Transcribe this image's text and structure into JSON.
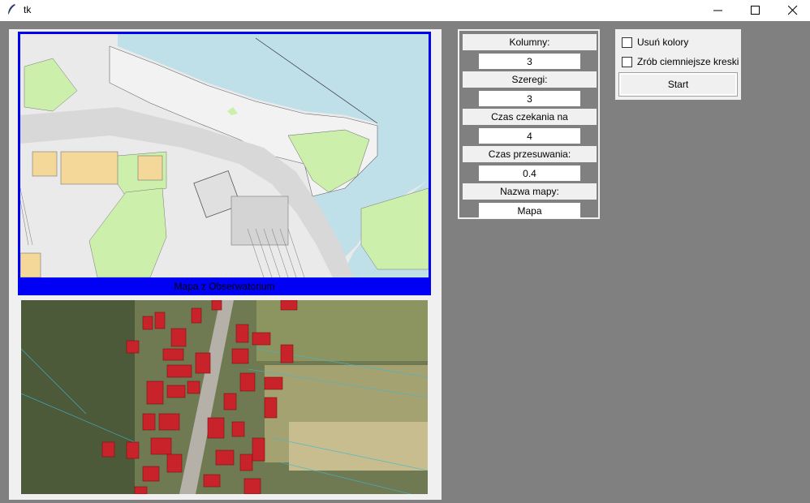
{
  "window": {
    "title": "tk",
    "icon": "feather-icon"
  },
  "window_controls": [
    "minimize-icon",
    "maximize-icon",
    "close-icon"
  ],
  "map_top": {
    "caption": "Mapa z Obserwatorium"
  },
  "params": {
    "columns_label": "Kolumny:",
    "columns_value": "3",
    "rows_label": "Szeregi:",
    "rows_value": "3",
    "wait_label": "Czas czekania na załadowanie:",
    "wait_value": "4",
    "shift_label": "Czas przesuwania:",
    "shift_value": "0.4",
    "name_label": "Nazwa mapy:",
    "name_value": "Mapa"
  },
  "options": {
    "remove_colors_label": "Usuń kolory",
    "remove_colors_checked": false,
    "darker_lines_label": "Zrób ciemniejsze kreski",
    "darker_lines_checked": false,
    "start_label": "Start"
  },
  "colors": {
    "frame_blue": "#0000f4",
    "water": "#bfdfe9",
    "park": "#ccefac",
    "building": "#f4d89a",
    "roof_red": "#c8232a"
  }
}
